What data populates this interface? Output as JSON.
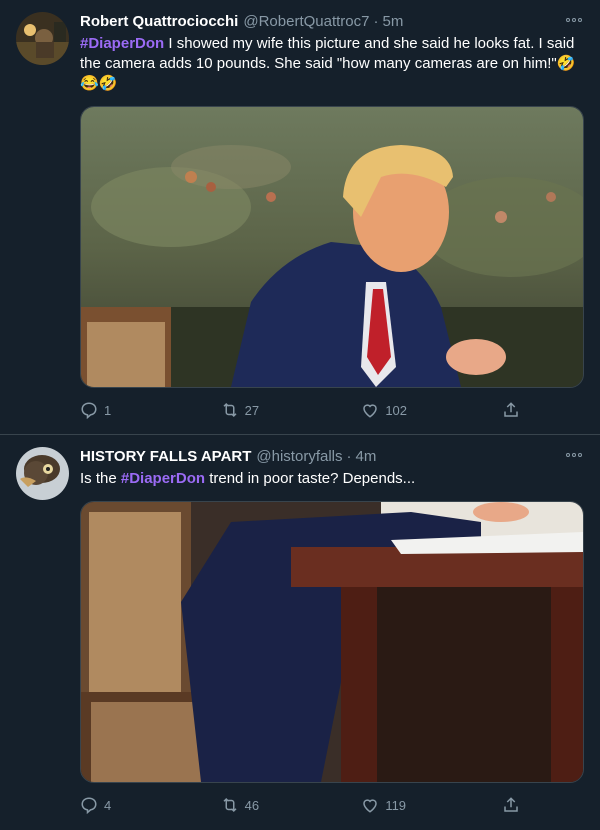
{
  "tweets": [
    {
      "display_name": "Robert Quattrociocchi",
      "handle": "@RobertQuattroc7",
      "separator": "·",
      "time": "5m",
      "hashtag": "#DiaperDon",
      "text_after_hashtag": " I showed my wife this picture and she said he looks fat. I said the camera  adds 10 pounds. She said \"how many cameras are on him!\"🤣😂🤣",
      "replies": "1",
      "retweets": "27",
      "likes": "102"
    },
    {
      "display_name": "HISTORY FALLS APART",
      "handle": "@historyfalls",
      "separator": "·",
      "time": "4m",
      "text_before_hashtag": "Is the ",
      "hashtag": "#DiaperDon",
      "text_after_hashtag": " trend in poor taste? Depends...",
      "replies": "4",
      "retweets": "46",
      "likes": "119"
    }
  ],
  "icons": {
    "reply": "reply-icon",
    "retweet": "retweet-icon",
    "like": "heart-icon",
    "share": "share-icon",
    "more": "more-icon"
  },
  "colors": {
    "background": "#15202b",
    "secondary_text": "#8899a6",
    "hashtag": "#9b6bf5",
    "divider": "#38444d"
  }
}
